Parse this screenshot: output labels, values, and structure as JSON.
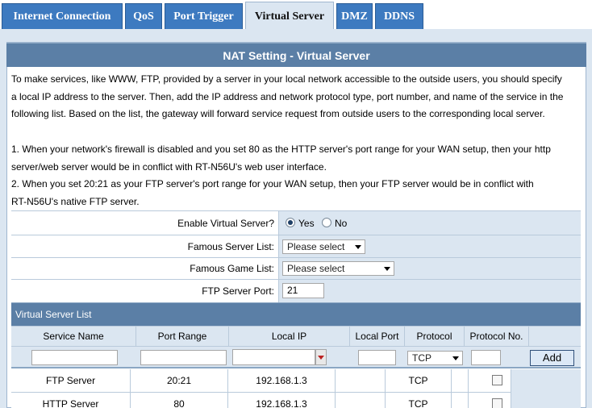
{
  "tabs": [
    {
      "label": "Internet Connection",
      "active": false
    },
    {
      "label": "QoS",
      "active": false
    },
    {
      "label": "Port Trigger",
      "active": false
    },
    {
      "label": "Virtual Server",
      "active": true
    },
    {
      "label": "DMZ",
      "active": false
    },
    {
      "label": "DDNS",
      "active": false
    }
  ],
  "panel": {
    "title": "NAT Setting - Virtual Server",
    "description": [
      "To make services, like WWW, FTP, provided by a server in your local network accessible to the outside users, you should specify",
      "a local IP address to the server. Then, add the IP address and network protocol type, port number, and name of the service in the",
      "following list. Based on the list, the gateway will forward service request from outside users to the corresponding local server."
    ],
    "notes": [
      "1. When your network's firewall is disabled and you set 80 as the HTTP server's port range for your WAN setup, then your http",
      "server/web server would be in conflict with RT-N56U's web user interface.",
      "2. When you set 20:21 as your FTP server's port range for your WAN setup, then your FTP server would be in conflict with",
      "RT-N56U's native FTP server."
    ]
  },
  "settings": {
    "enable_label": "Enable Virtual Server?",
    "yes_label": "Yes",
    "no_label": "No",
    "enabled": "Yes",
    "famous_server_label": "Famous Server List:",
    "famous_server_value": "Please select",
    "famous_game_label": "Famous Game List:",
    "famous_game_value": "Please select",
    "ftp_port_label": "FTP Server Port:",
    "ftp_port_value": "21"
  },
  "list": {
    "title": "Virtual Server List",
    "columns": [
      "Service Name",
      "Port Range",
      "Local IP",
      "Local Port",
      "Protocol",
      "Protocol No."
    ],
    "protocol_default": "TCP",
    "add_label": "Add",
    "rows": [
      {
        "service": "FTP Server",
        "port_range": "20:21",
        "local_ip": "192.168.1.3",
        "local_port": "",
        "protocol": "TCP",
        "protocol_no": ""
      },
      {
        "service": "HTTP Server",
        "port_range": "80",
        "local_ip": "192.168.1.3",
        "local_port": "",
        "protocol": "TCP",
        "protocol_no": ""
      }
    ]
  },
  "colors": {
    "tab_bg": "#3d7ac0",
    "tab_active_bg": "#dbe6f1",
    "header_bg": "#5b7fa6",
    "cell_bg": "#dbe6f1"
  }
}
